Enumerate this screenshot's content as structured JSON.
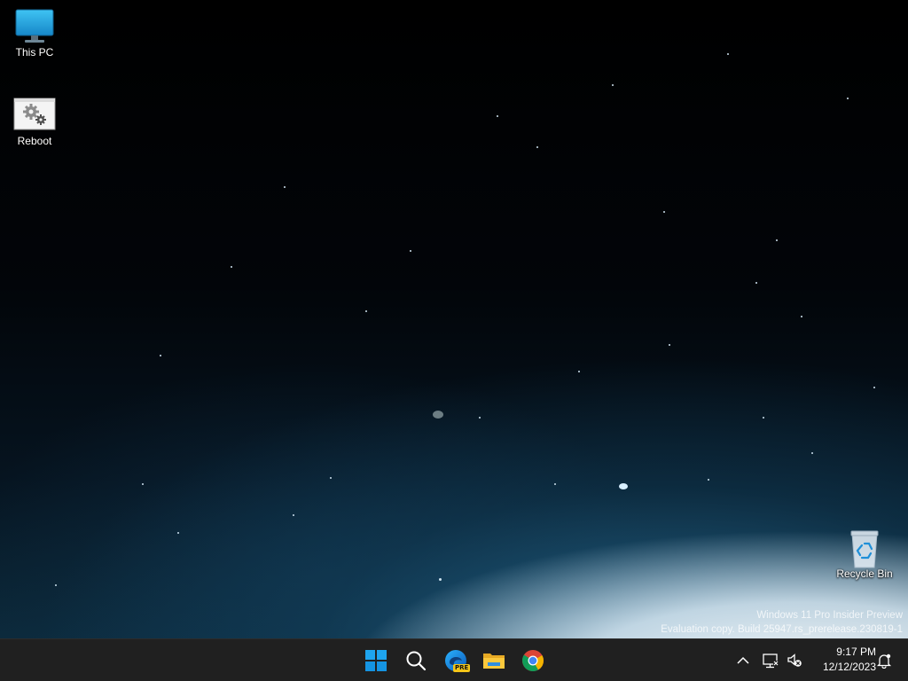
{
  "desktop": {
    "icons": [
      {
        "label": "This PC",
        "icon": "monitor-icon"
      },
      {
        "label": "Reboot",
        "icon": "gear-window-icon"
      },
      {
        "label": "Recycle Bin",
        "icon": "recycle-bin-icon"
      }
    ],
    "watermark": {
      "line1": "Windows 11 Pro Insider Preview",
      "line2": "Evaluation copy. Build 25947.rs_prerelease.230819-1"
    }
  },
  "taskbar": {
    "apps": [
      {
        "name": "Start",
        "icon": "windows-logo-icon"
      },
      {
        "name": "Search",
        "icon": "search-icon"
      },
      {
        "name": "Microsoft Edge Canary",
        "icon": "edge-canary-icon",
        "badge": "PRE"
      },
      {
        "name": "File Explorer",
        "icon": "folder-icon"
      },
      {
        "name": "Google Chrome",
        "icon": "chrome-icon"
      }
    ],
    "tray": {
      "overflow_icon": "chevron-up-icon",
      "network_icon": "network-icon",
      "volume_icon": "speaker-muted-icon",
      "notification_icon": "notification-bell-icon"
    },
    "clock": {
      "time": "9:17 PM",
      "date": "12/12/2023"
    }
  },
  "colors": {
    "taskbar_bg": "#202020",
    "accent_blue": "#0078d4"
  }
}
